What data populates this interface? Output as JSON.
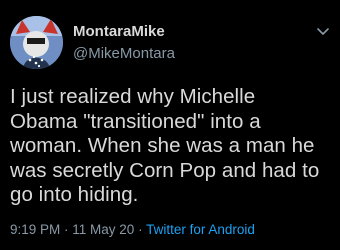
{
  "tweet": {
    "display_name": "MontaraMike",
    "handle": "@MikeMontara",
    "body_lines": [
      "I just realized why Michelle",
      "Obama \"transitioned\" into a",
      "woman. When she was a man he",
      "was secretly Corn Pop and had to",
      "go into hiding."
    ],
    "time": "9:19 PM",
    "separator": " · ",
    "date": "11 May 20",
    "source": "Twitter for Android"
  },
  "icons": {
    "menu": "chevron-down-icon",
    "avatar": "avatar"
  },
  "colors": {
    "background": "#000000",
    "text": "#d9d9d9",
    "muted": "#8899a6",
    "link": "#1da1f2"
  }
}
